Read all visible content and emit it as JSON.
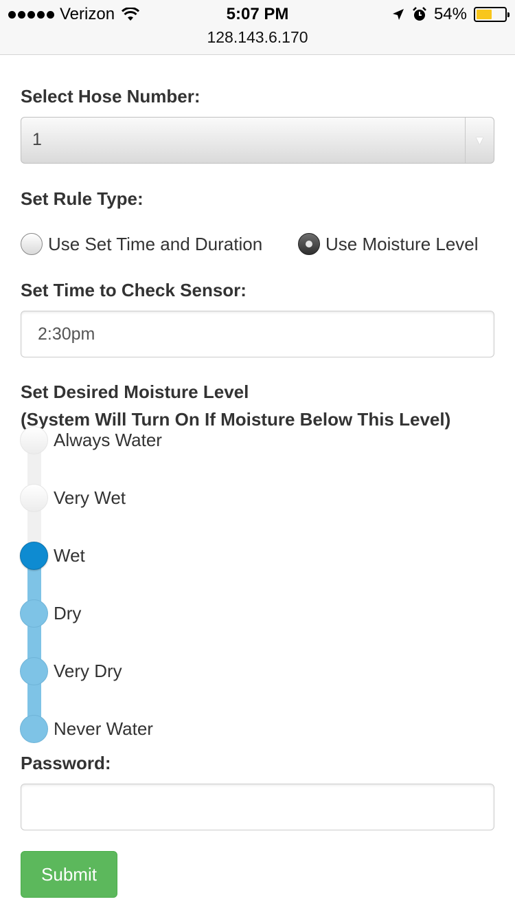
{
  "status_bar": {
    "carrier": "Verizon",
    "time": "5:07 PM",
    "battery_percent": "54%",
    "battery_level": 0.54,
    "icons": [
      "signal-dots-icon",
      "wifi-icon",
      "location-arrow-icon",
      "alarm-icon",
      "battery-icon"
    ]
  },
  "browser": {
    "url": "128.143.6.170"
  },
  "form": {
    "hose_label": "Select Hose Number:",
    "hose_selected": "1",
    "rule_label": "Set Rule Type:",
    "rule_options": [
      {
        "label": "Use Set Time and Duration",
        "checked": false
      },
      {
        "label": "Use Moisture Level",
        "checked": true
      }
    ],
    "time_label": "Set Time to Check Sensor:",
    "time_value": "2:30pm",
    "moisture_label_line1": "Set Desired Moisture Level",
    "moisture_label_line2": "(System Will Turn On If Moisture Below This Level)",
    "moisture_levels": [
      "Always Water",
      "Very Wet",
      "Wet",
      "Dry",
      "Very Dry",
      "Never Water"
    ],
    "moisture_selected": "Wet",
    "password_label": "Password:",
    "password_value": "",
    "submit_label": "Submit"
  },
  "colors": {
    "accent_blue": "#0e8bd1",
    "track_blue": "#7ec3e6",
    "submit_green": "#5cb85c",
    "battery_yellow": "#f8c61c"
  }
}
